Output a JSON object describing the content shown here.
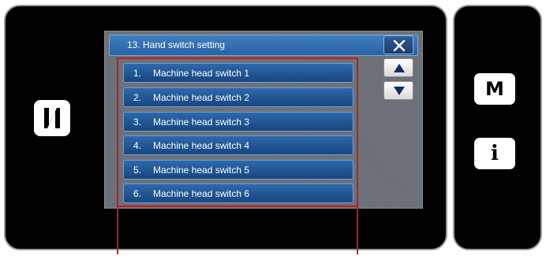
{
  "device": {
    "nfc_icon": "nfc-n-icon",
    "menu_button_label": "M",
    "info_button_label": "i"
  },
  "dialog": {
    "title": "13.  Hand switch setting",
    "close_icon": "close-x-icon",
    "scroll_up_icon": "triangle-up-icon",
    "scroll_down_icon": "triangle-down-icon",
    "items": [
      {
        "number": "1.",
        "label": "Machine head switch 1"
      },
      {
        "number": "2.",
        "label": "Machine head switch 2"
      },
      {
        "number": "3.",
        "label": "Machine head switch 3"
      },
      {
        "number": "4.",
        "label": "Machine head switch 4"
      },
      {
        "number": "5.",
        "label": "Machine head switch 5"
      },
      {
        "number": "6.",
        "label": "Machine head switch 6"
      }
    ]
  },
  "colors": {
    "accent_blue": "#2d69ab",
    "highlight_red": "#c31a1a"
  }
}
